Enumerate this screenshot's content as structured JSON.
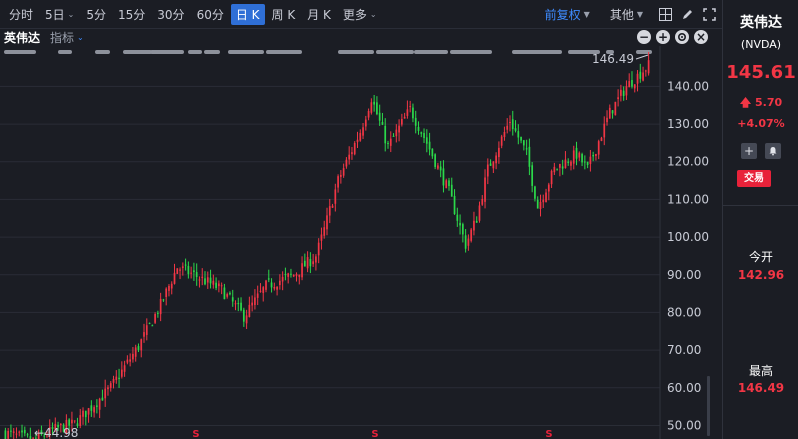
{
  "toolbar": {
    "periods": [
      {
        "label": "分时",
        "caret": false,
        "active": false
      },
      {
        "label": "5日",
        "caret": true,
        "active": false
      },
      {
        "label": "5分",
        "caret": false,
        "active": false
      },
      {
        "label": "15分",
        "caret": false,
        "active": false
      },
      {
        "label": "30分",
        "caret": false,
        "active": false
      },
      {
        "label": "60分",
        "caret": false,
        "active": false
      },
      {
        "label": "日 K",
        "caret": false,
        "active": true
      },
      {
        "label": "周 K",
        "caret": false,
        "active": false
      },
      {
        "label": "月 K",
        "caret": false,
        "active": false
      },
      {
        "label": "更多",
        "caret": true,
        "active": false
      }
    ],
    "adjust_label": "前复权",
    "other_label": "其他"
  },
  "legend": {
    "stock_name": "英伟达",
    "indicator_label": "指标"
  },
  "sidebar": {
    "name": "英伟达",
    "ticker": "(NVDA)",
    "price": "145.61",
    "change": "5.70",
    "change_pct": "+4.07%",
    "trade_label": "交易",
    "open_label": "今开",
    "open_value": "142.96",
    "high_label": "最高",
    "high_value": "146.49"
  },
  "colors": {
    "up": "#f23645",
    "down": "#2bd94a",
    "accent": "#2f6fd6",
    "background": "#1b1d24"
  },
  "chart_data": {
    "type": "candlestick",
    "y_ticks": [
      50,
      60,
      70,
      80,
      90,
      100,
      110,
      120,
      130,
      140
    ],
    "y_tick_labels": [
      "50.00",
      "60.00",
      "70.00",
      "80.00",
      "90.00",
      "100.00",
      "110.00",
      "120.00",
      "130.00",
      "140.00"
    ],
    "y_range": [
      46.4,
      148.6
    ],
    "max_label": "146.49",
    "min_label": "44.98",
    "x_markers": [
      "S",
      "S",
      "S"
    ],
    "anchors": [
      [
        0,
        48.0
      ],
      [
        10,
        46.0
      ],
      [
        18,
        49.0
      ],
      [
        25,
        50.5
      ],
      [
        38,
        60.0
      ],
      [
        48,
        71.0
      ],
      [
        56,
        82.0
      ],
      [
        62,
        92.0
      ],
      [
        68,
        90.0
      ],
      [
        78,
        86.0
      ],
      [
        86,
        79.0
      ],
      [
        94,
        87.0
      ],
      [
        104,
        90.0
      ],
      [
        112,
        95.0
      ],
      [
        115,
        102.0
      ],
      [
        120,
        115.0
      ],
      [
        128,
        128.0
      ],
      [
        132,
        137.0
      ],
      [
        138,
        124.0
      ],
      [
        146,
        134.0
      ],
      [
        152,
        125.0
      ],
      [
        160,
        112.0
      ],
      [
        166,
        98.0
      ],
      [
        170,
        105.0
      ],
      [
        174,
        118.0
      ],
      [
        182,
        131.0
      ],
      [
        188,
        122.0
      ],
      [
        192,
        108.0
      ],
      [
        198,
        118.0
      ],
      [
        206,
        122.0
      ],
      [
        210,
        118.0
      ],
      [
        218,
        133.0
      ],
      [
        224,
        140.0
      ],
      [
        232,
        145.6
      ]
    ]
  }
}
